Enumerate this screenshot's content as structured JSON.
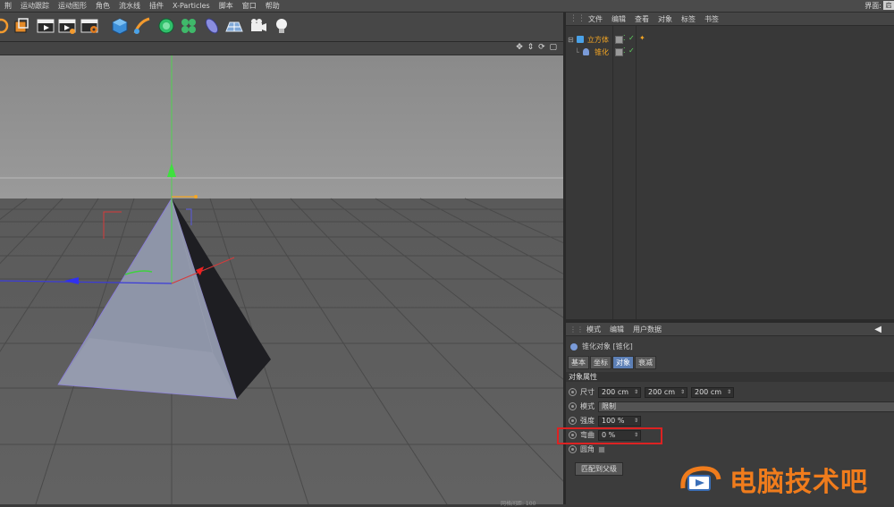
{
  "menu": [
    "荆",
    "运动跟踪",
    "运动图形",
    "角色",
    "流水线",
    "插件",
    "X-Particles",
    "脚本",
    "窗口",
    "帮助"
  ],
  "layout": {
    "label": "界面:",
    "value": "启"
  },
  "objects_menu": [
    "文件",
    "编辑",
    "查看",
    "对象",
    "标签",
    "书签"
  ],
  "objects": [
    {
      "name": "立方体",
      "selected": true
    },
    {
      "name": "锥化",
      "selected": false
    }
  ],
  "attr_menu": [
    "模式",
    "编辑",
    "用户数据"
  ],
  "attr_title": "锥化对象 [锥化]",
  "attr_tabs": [
    {
      "label": "基本",
      "active": false
    },
    {
      "label": "坐标",
      "active": false
    },
    {
      "label": "对象",
      "active": true
    },
    {
      "label": "衰减",
      "active": false
    }
  ],
  "section_title": "对象属性",
  "props": {
    "size": {
      "label": "尺寸",
      "values": [
        "200 cm",
        "200 cm",
        "200 cm"
      ]
    },
    "mode": {
      "label": "模式",
      "value": "限制"
    },
    "strength": {
      "label": "强度",
      "value": "100 %"
    },
    "curvature": {
      "label": "弯曲",
      "value": "0 %"
    },
    "fillet": {
      "label": "圆角"
    }
  },
  "match_button": "匹配到父级",
  "watermark": "电脑技术吧",
  "status_text": "网格间距: 100",
  "colors": {
    "accent_orange": "#f5a623",
    "highlight_red": "#dd2222",
    "tab_active": "#5c7fb5"
  }
}
